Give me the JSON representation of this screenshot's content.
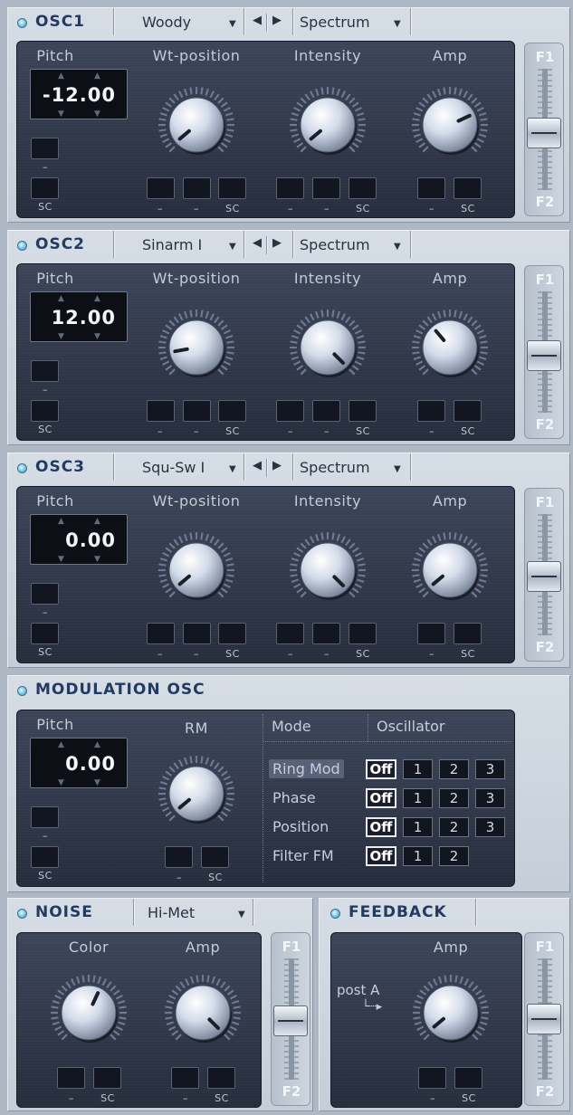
{
  "osc1": {
    "title": "OSC1",
    "waveform": "Woody",
    "view_mode": "Spectrum",
    "labels": {
      "pitch": "Pitch",
      "wt": "Wt-position",
      "intensity": "Intensity",
      "amp": "Amp"
    },
    "pitch_value": "-12.00",
    "fader": {
      "top": "F1",
      "bottom": "F2"
    },
    "mod_dash": "–",
    "mod_sc": "SC"
  },
  "osc2": {
    "title": "OSC2",
    "waveform": "Sinarm I",
    "view_mode": "Spectrum",
    "labels": {
      "pitch": "Pitch",
      "wt": "Wt-position",
      "intensity": "Intensity",
      "amp": "Amp"
    },
    "pitch_value": "12.00",
    "fader": {
      "top": "F1",
      "bottom": "F2"
    },
    "mod_dash": "–",
    "mod_sc": "SC"
  },
  "osc3": {
    "title": "OSC3",
    "waveform": "Squ-Sw I",
    "view_mode": "Spectrum",
    "labels": {
      "pitch": "Pitch",
      "wt": "Wt-position",
      "intensity": "Intensity",
      "amp": "Amp"
    },
    "pitch_value": "0.00",
    "fader": {
      "top": "F1",
      "bottom": "F2"
    },
    "mod_dash": "–",
    "mod_sc": "SC"
  },
  "modosc": {
    "title": "MODULATION OSC",
    "labels": {
      "pitch": "Pitch",
      "rm": "RM",
      "mode": "Mode",
      "oscillator": "Oscillator"
    },
    "pitch_value": "0.00",
    "mod_dash": "–",
    "mod_sc": "SC",
    "rows": [
      {
        "label": "Ring Mod",
        "off": "Off",
        "buttons": [
          "1",
          "2",
          "3"
        ]
      },
      {
        "label": "Phase",
        "off": "Off",
        "buttons": [
          "1",
          "2",
          "3"
        ]
      },
      {
        "label": "Position",
        "off": "Off",
        "buttons": [
          "1",
          "2",
          "3"
        ]
      },
      {
        "label": "Filter FM",
        "off": "Off",
        "buttons": [
          "1",
          "2"
        ]
      }
    ]
  },
  "noise": {
    "title": "NOISE",
    "type": "Hi-Met",
    "labels": {
      "color": "Color",
      "amp": "Amp"
    },
    "fader": {
      "top": "F1",
      "bottom": "F2"
    },
    "mod_dash": "–",
    "mod_sc": "SC"
  },
  "feedback": {
    "title": "FEEDBACK",
    "labels": {
      "amp": "Amp",
      "post": "post A"
    },
    "fader": {
      "top": "F1",
      "bottom": "F2"
    },
    "mod_dash": "–",
    "mod_sc": "SC"
  },
  "colors": {
    "led": "#7fd0f2",
    "title": "#233b63",
    "panel": "#cdd5de",
    "display_bg": "#262d3d"
  }
}
